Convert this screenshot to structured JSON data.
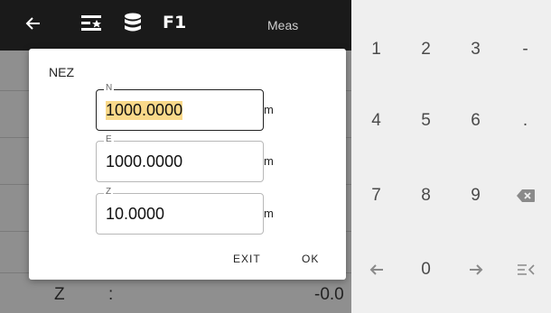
{
  "topbar": {
    "title_f1": "F1",
    "mode": "Meas",
    "icons": [
      "back-arrow-icon",
      "list-star-icon",
      "database-icon"
    ]
  },
  "background": {
    "z_label": "Z",
    "z_colon": ":",
    "z_value": "-0.0"
  },
  "dialog": {
    "title": "NEZ",
    "fields": {
      "n": {
        "label": "N",
        "value": "1000.0000",
        "unit": "m"
      },
      "e": {
        "label": "E",
        "value": "1000.0000",
        "unit": "m"
      },
      "z": {
        "label": "Z",
        "value": "10.0000",
        "unit": "m"
      }
    },
    "exit_label": "EXIT",
    "ok_label": "OK"
  },
  "keypad": {
    "row1": [
      "1",
      "2",
      "3",
      "-"
    ],
    "row2": [
      "4",
      "5",
      "6",
      "."
    ],
    "row3": [
      "7",
      "8",
      "9"
    ],
    "row4": [
      "0"
    ],
    "icons": [
      "backspace-icon",
      "left-arrow-icon",
      "right-arrow-icon",
      "collapse-keyboard-icon"
    ]
  }
}
